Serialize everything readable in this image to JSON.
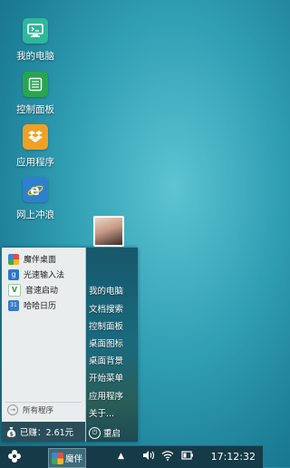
{
  "desktop": {
    "icons": [
      {
        "label": "我的电脑",
        "icon": "computer-icon",
        "color": "#2fb79a"
      },
      {
        "label": "控制面板",
        "icon": "control-panel-icon",
        "color": "#27a64d"
      },
      {
        "label": "应用程序",
        "icon": "dropbox-icon",
        "color": "#f0a024"
      },
      {
        "label": "网上冲浪",
        "icon": "ie-browser-icon",
        "color": "#2f7fcf"
      }
    ]
  },
  "start_menu": {
    "apps": [
      {
        "label": "魔伴桌面",
        "icon": "mobanzhuomian-icon"
      },
      {
        "label": "光速输入法",
        "icon": "input-method-icon"
      },
      {
        "label": "音速启动",
        "icon": "vstart-icon"
      },
      {
        "label": "哈哈日历",
        "icon": "calendar-icon"
      }
    ],
    "all_programs": "所有程序",
    "earned": "已赚：2.61元",
    "right_items": [
      "我的电脑",
      "文档搜索",
      "控制面板",
      "桌面图标",
      "桌面背景",
      "开始菜单",
      "应用程序",
      "关于..."
    ],
    "restart": "重启"
  },
  "taskbar": {
    "app_label": "魔伴",
    "clock": "17:12:32"
  }
}
